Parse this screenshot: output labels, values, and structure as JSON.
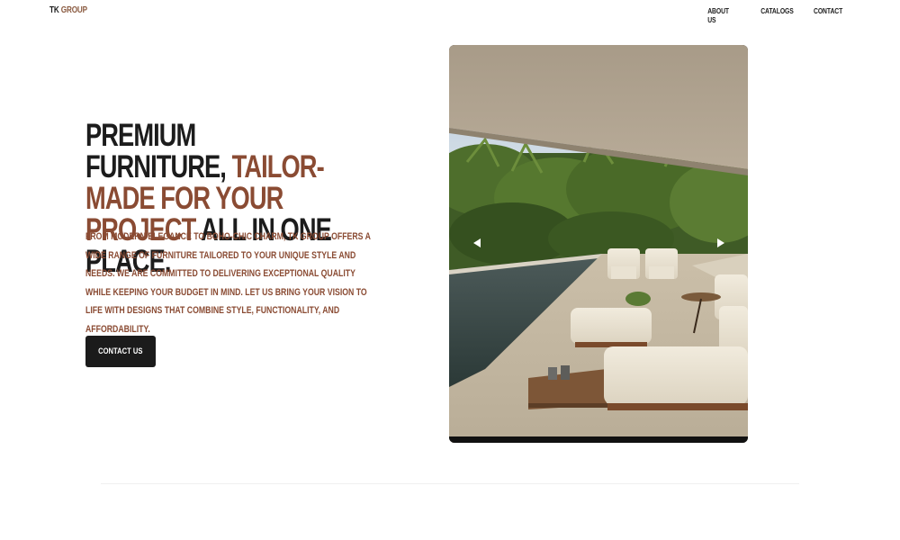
{
  "header": {
    "logo_primary": "TK",
    "logo_accent": "GROUP",
    "nav": [
      {
        "label": "ABOUT US"
      },
      {
        "label": "CATALOGS"
      },
      {
        "label": "CONTACT"
      }
    ]
  },
  "hero": {
    "title_part1": "PREMIUM FURNITURE,",
    "title_accent": "TAILOR-MADE FOR YOUR PROJECT",
    "title_part2": "ALL IN ONE PLACE.",
    "description": "FROM MODERN ELEGANCE TO BOHO-CHIC CHARM, TK GROUP OFFERS A WIDE RANGE OF FURNITURE TAILORED TO YOUR UNIQUE STYLE AND NEEDS. WE ARE COMMITTED TO DELIVERING EXCEPTIONAL QUALITY WHILE KEEPING YOUR BUDGET IN MIND. LET US BRING YOUR VISION TO LIFE WITH DESIGNS THAT COMBINE STYLE, FUNCTIONALITY, AND AFFORDABILITY.",
    "cta_label": "CONTACT US"
  },
  "carousel": {
    "prev_icon": "triangle-left-icon",
    "next_icon": "triangle-right-icon"
  },
  "colors": {
    "accent": "#8a4b33",
    "dark": "#1b1b1b",
    "background": "#ffffff"
  }
}
